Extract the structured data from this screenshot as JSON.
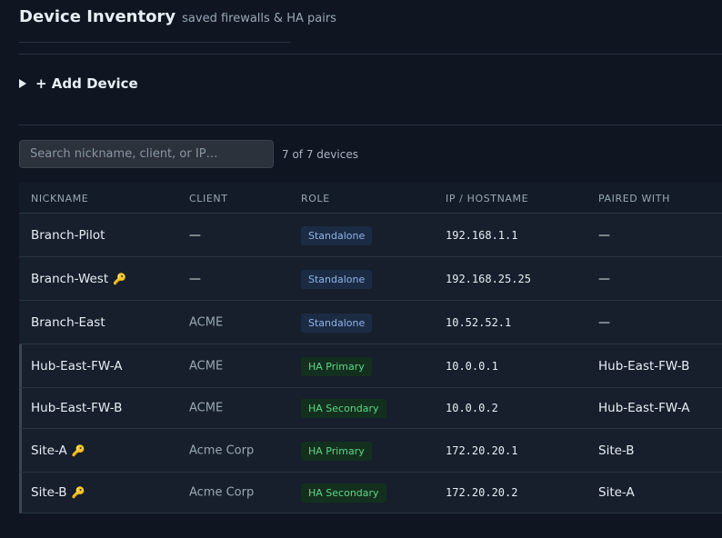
{
  "header": {
    "title": "Device Inventory",
    "subtitle": "saved firewalls & HA pairs"
  },
  "add_device": {
    "label": "+ Add Device"
  },
  "search": {
    "placeholder": "Search nickname, client, or IP…",
    "value": ""
  },
  "device_count": "7 of 7 devices",
  "table": {
    "columns": [
      "NICKNAME",
      "CLIENT",
      "ROLE",
      "IP / HOSTNAME",
      "PAIRED WITH"
    ],
    "rows": [
      {
        "nickname": "Branch-Pilot",
        "key": false,
        "client": "—",
        "role": "Standalone",
        "role_type": "standalone",
        "ip": "192.168.1.1",
        "paired": "—",
        "ha": false
      },
      {
        "nickname": "Branch-West",
        "key": true,
        "client": "—",
        "role": "Standalone",
        "role_type": "standalone",
        "ip": "192.168.25.25",
        "paired": "—",
        "ha": false
      },
      {
        "nickname": "Branch-East",
        "key": false,
        "client": "ACME",
        "role": "Standalone",
        "role_type": "standalone",
        "ip": "10.52.52.1",
        "paired": "—",
        "ha": false
      },
      {
        "nickname": "Hub-East-FW-A",
        "key": false,
        "client": "ACME",
        "role": "HA Primary",
        "role_type": "ha",
        "ip": "10.0.0.1",
        "paired": "Hub-East-FW-B",
        "ha": true
      },
      {
        "nickname": "Hub-East-FW-B",
        "key": false,
        "client": "ACME",
        "role": "HA Secondary",
        "role_type": "ha",
        "ip": "10.0.0.2",
        "paired": "Hub-East-FW-A",
        "ha": true
      },
      {
        "nickname": "Site-A",
        "key": true,
        "client": "Acme Corp",
        "role": "HA Primary",
        "role_type": "ha",
        "ip": "172.20.20.1",
        "paired": "Site-B",
        "ha": true
      },
      {
        "nickname": "Site-B",
        "key": true,
        "client": "Acme Corp",
        "role": "HA Secondary",
        "role_type": "ha",
        "ip": "172.20.20.2",
        "paired": "Site-A",
        "ha": true
      }
    ]
  },
  "icons": {
    "key": "key-icon",
    "caret": "caret-right-icon"
  },
  "colors": {
    "background": "#0f1621",
    "standalone_badge": "#1c2b44",
    "standalone_text": "#8fb4e8",
    "ha_badge": "#13301f",
    "ha_text": "#5fd586",
    "key": "#e8b43c"
  }
}
